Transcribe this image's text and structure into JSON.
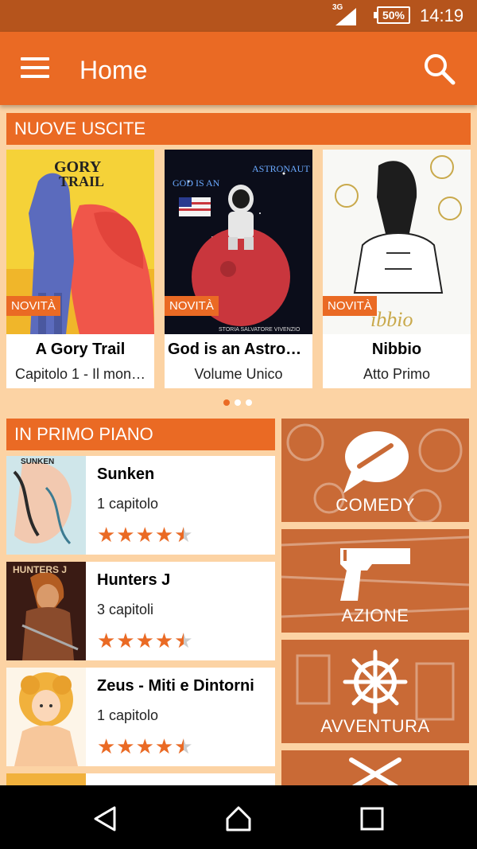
{
  "status_bar": {
    "network": "3G",
    "battery": "50%",
    "time": "14:19"
  },
  "toolbar": {
    "title": "Home"
  },
  "new_releases": {
    "header": "NUOVE USCITE",
    "items": [
      {
        "title": "A Gory Trail",
        "subtitle": "Capitolo 1 - Il mon…",
        "badge": "NOVITÀ",
        "cover_text": "A GORY TRAIL"
      },
      {
        "title": "God is an Astron…",
        "subtitle": "Volume Unico",
        "badge": "NOVITÀ",
        "cover_text": "GOD IS AN ASTRONAUT",
        "cover_caption": "STORIA SALVATORE VIVENZIO"
      },
      {
        "title": "Nibbio",
        "subtitle": "Atto Primo",
        "badge": "NOVITÀ",
        "cover_text": "NIBBIO"
      }
    ]
  },
  "featured": {
    "header": "IN PRIMO PIANO",
    "items": [
      {
        "title": "Sunken",
        "subtitle": "1 capitolo",
        "rating": 4.5,
        "cover_text": "SUNKEN"
      },
      {
        "title": "Hunters J",
        "subtitle": "3 capitoli",
        "rating": 4.5,
        "cover_text": "HUNTERS J"
      },
      {
        "title": "Zeus - Miti e Dintorni",
        "subtitle": "1 capitolo",
        "rating": 4.5
      }
    ]
  },
  "genres": [
    {
      "label": "COMEDY",
      "icon": "speech-bubble-icon"
    },
    {
      "label": "AZIONE",
      "icon": "pistol-icon"
    },
    {
      "label": "AVVENTURA",
      "icon": "ship-wheel-icon"
    },
    {
      "label": "",
      "icon": "crossed-swords-icon"
    }
  ],
  "colors": {
    "accent": "#ea6a24",
    "status_bar": "#b5541c",
    "background": "#fcd3a4",
    "genre_tile": "#c96a36"
  }
}
